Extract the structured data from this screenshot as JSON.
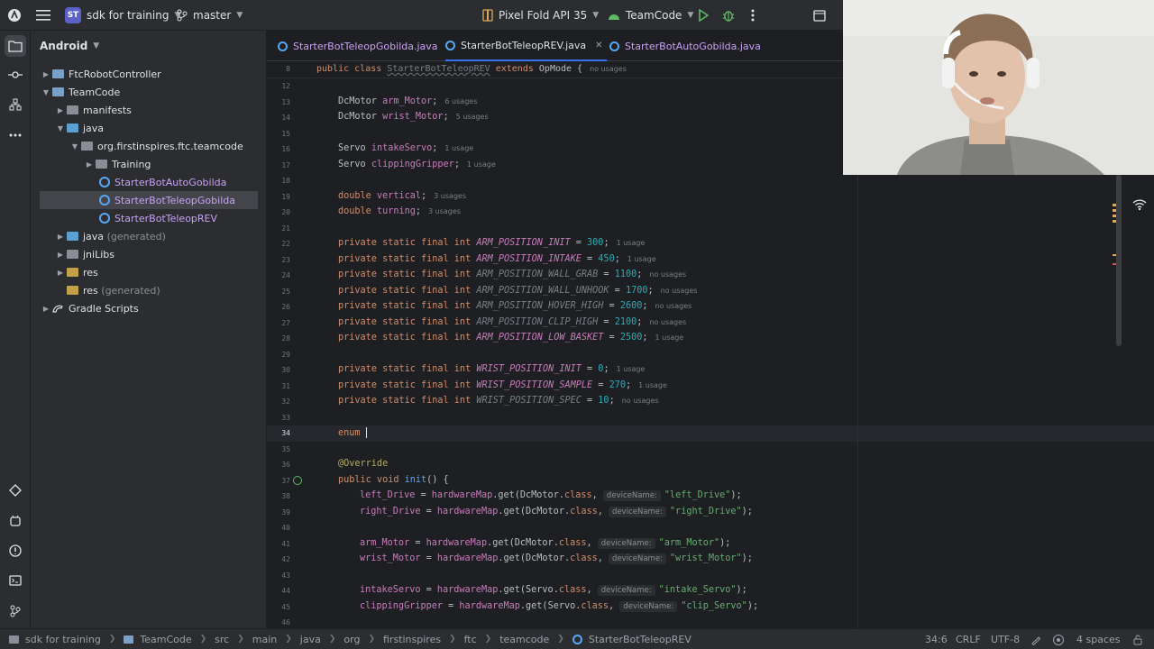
{
  "titlebar": {
    "project_badge": "ST",
    "project_name": "sdk for training",
    "branch": "master",
    "device": "Pixel Fold API 35",
    "run_config": "TeamCode"
  },
  "project_panel": {
    "title": "Android",
    "items": [
      {
        "label": "FtcRobotController",
        "suffix": ""
      },
      {
        "label": "TeamCode",
        "suffix": ""
      },
      {
        "label": "manifests",
        "suffix": ""
      },
      {
        "label": "java",
        "suffix": ""
      },
      {
        "label": "org.firstinspires.ftc.teamcode",
        "suffix": ""
      },
      {
        "label": "Training",
        "suffix": ""
      },
      {
        "label": "StarterBotAutoGobilda",
        "suffix": ""
      },
      {
        "label": "StarterBotTeleopGobilda",
        "suffix": ""
      },
      {
        "label": "StarterBotTeleopREV",
        "suffix": ""
      },
      {
        "label": "java",
        "suffix": "(generated)"
      },
      {
        "label": "jniLibs",
        "suffix": ""
      },
      {
        "label": "res",
        "suffix": ""
      },
      {
        "label": "res",
        "suffix": "(generated)"
      },
      {
        "label": "Gradle Scripts",
        "suffix": ""
      }
    ]
  },
  "tabs": [
    {
      "label": "StarterBotTeleopGobilda.java"
    },
    {
      "label": "StarterBotTeleopREV.java"
    },
    {
      "label": "StarterBotAutoGobilda.java"
    }
  ],
  "sticky": {
    "line": "8",
    "public": "public",
    "class": "class",
    "name": "StarterBotTeleopREV",
    "extends": "extends",
    "parent": "OpMode {",
    "usage": "no usages"
  },
  "code": [
    {
      "n": "12"
    },
    {
      "n": "13",
      "type": "DcMotor",
      "name": "arm_Motor",
      "usage": "6 usages"
    },
    {
      "n": "14",
      "type": "DcMotor",
      "name": "wrist_Motor",
      "usage": "5 usages"
    },
    {
      "n": "15"
    },
    {
      "n": "16",
      "type": "Servo",
      "name": "intakeServo",
      "usage": "1 usage"
    },
    {
      "n": "17",
      "type": "Servo",
      "name": "clippingGripper",
      "usage": "1 usage"
    },
    {
      "n": "18"
    },
    {
      "n": "19",
      "type": "double",
      "name": "vertical",
      "usage": "3 usages"
    },
    {
      "n": "20",
      "type": "double",
      "name": "turning",
      "usage": "3 usages"
    },
    {
      "n": "21"
    },
    {
      "n": "22",
      "prefix": "private static final int",
      "name": "ARM_POSITION_INIT",
      "value": "300",
      "usage": "1 usage"
    },
    {
      "n": "23",
      "prefix": "private static final int",
      "name": "ARM_POSITION_INTAKE",
      "value": "450",
      "usage": "1 usage"
    },
    {
      "n": "24",
      "prefix": "private static final int",
      "name": "ARM_POSITION_WALL_GRAB",
      "value": "1100",
      "usage": "no usages"
    },
    {
      "n": "25",
      "prefix": "private static final int",
      "name": "ARM_POSITION_WALL_UNHOOK",
      "value": "1700",
      "usage": "no usages"
    },
    {
      "n": "26",
      "prefix": "private static final int",
      "name": "ARM_POSITION_HOVER_HIGH",
      "value": "2600",
      "usage": "no usages"
    },
    {
      "n": "27",
      "prefix": "private static final int",
      "name": "ARM_POSITION_CLIP_HIGH",
      "value": "2100",
      "usage": "no usages"
    },
    {
      "n": "28",
      "prefix": "private static final int",
      "name": "ARM_POSITION_LOW_BASKET",
      "value": "2500",
      "usage": "1 usage"
    },
    {
      "n": "29"
    },
    {
      "n": "30",
      "prefix": "private static final int",
      "name": "WRIST_POSITION_INIT",
      "value": "0",
      "usage": "1 usage"
    },
    {
      "n": "31",
      "prefix": "private static final int",
      "name": "WRIST_POSITION_SAMPLE",
      "value": "270",
      "usage": "1 usage"
    },
    {
      "n": "32",
      "prefix": "private static final int",
      "name": "WRIST_POSITION_SPEC",
      "value": "10",
      "usage": "no usages"
    },
    {
      "n": "33"
    },
    {
      "n": "34",
      "text": "enum "
    },
    {
      "n": "35"
    },
    {
      "n": "36",
      "text": "@Override"
    },
    {
      "n": "37",
      "text": "public void",
      "fn": "init",
      "rest": "() {"
    },
    {
      "n": "38",
      "lhs": "left_Drive",
      "obj": "hardwareMap",
      "cls": "DcMotor",
      "hint": "deviceName:",
      "str": "\"left_Drive\""
    },
    {
      "n": "39",
      "lhs": "right_Drive",
      "obj": "hardwareMap",
      "cls": "DcMotor",
      "hint": "deviceName:",
      "str": "\"right_Drive\""
    },
    {
      "n": "40"
    },
    {
      "n": "41",
      "lhs": "arm_Motor",
      "obj": "hardwareMap",
      "cls": "DcMotor",
      "hint": "deviceName:",
      "str": "\"arm_Motor\""
    },
    {
      "n": "42",
      "lhs": "wrist_Motor",
      "obj": "hardwareMap",
      "cls": "DcMotor",
      "hint": "deviceName:",
      "str": "\"wrist_Motor\""
    },
    {
      "n": "43"
    },
    {
      "n": "44",
      "lhs": "intakeServo",
      "obj": "hardwareMap",
      "cls": "Servo",
      "hint": "deviceName:",
      "str": "\"intake_Servo\""
    },
    {
      "n": "45",
      "lhs": "clippingGripper",
      "obj": "hardwareMap",
      "cls": "Servo",
      "hint": "deviceName:",
      "str": "\"clip_Servo\""
    },
    {
      "n": "46"
    }
  ],
  "statusbar": {
    "crumbs": [
      "sdk for training",
      "TeamCode",
      "src",
      "main",
      "java",
      "org",
      "firstinspires",
      "ftc",
      "teamcode",
      "StarterBotTeleopREV"
    ],
    "position": "34:6",
    "line_sep": "CRLF",
    "encoding": "UTF-8",
    "indent": "4 spaces"
  },
  "colors": {
    "accent": "#3574f0",
    "keyword": "#cf8e6d",
    "field": "#c77dbb",
    "number": "#2aacb8",
    "string": "#6aab73"
  }
}
